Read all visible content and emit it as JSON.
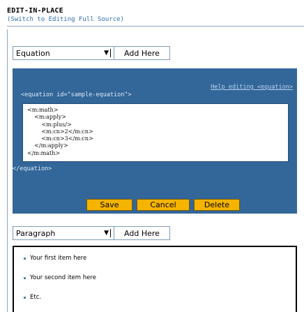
{
  "header": {
    "title": "EDIT-IN-PLACE",
    "switch_link": "(Switch to Editing Full Source)"
  },
  "equation_chooser": {
    "selected": "Equation",
    "add_label": "Add Here"
  },
  "equation_editor": {
    "help_link": "Help editing <equation>",
    "open_tag": "<equation id=\"sample-equation\">",
    "source": "<m:math>\n    <m:apply>\n        <m:plus/>\n        <m:cn>2</m:cn>\n        <m:cn>3</m:cn>\n    </m:apply>\n</m:math>",
    "close_tag": "</equation>",
    "save_label": "Save",
    "cancel_label": "Cancel",
    "delete_label": "Delete",
    "panel_color": "#336699",
    "button_color": "#f5b400"
  },
  "paragraph_chooser": {
    "selected": "Paragraph",
    "add_label": "Add Here"
  },
  "list": {
    "items": [
      "Your first item here",
      "Your second item here",
      "Etc."
    ]
  }
}
